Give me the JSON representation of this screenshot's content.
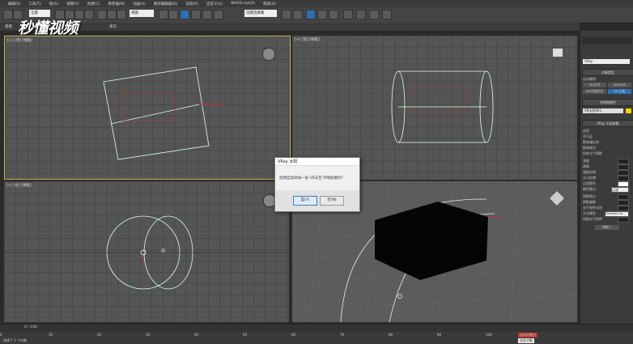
{
  "menu": [
    "编辑(E)",
    "工具(T)",
    "组(G)",
    "视图(V)",
    "创建(C)",
    "修改器(M)",
    "动画(A)",
    "图形编辑器(D)",
    "渲染(R)",
    "自定义(U)",
    "MAXScript(X)",
    "帮助(H)"
  ],
  "toolbar": {
    "select_filter": "全部",
    "view_dropdown": "视图",
    "selection_set": "创建选择集"
  },
  "logo": {
    "text": "秒懂视频"
  },
  "ribbon": {
    "left": "建模",
    "right": "填充"
  },
  "viewports": {
    "top_left": "[+] [顶] [线框]",
    "top_right": "[+] [前] [线框]",
    "bottom_left": "[+] [左] [线框]",
    "bottom_right": "[+] [透视] [真实]"
  },
  "dialog": {
    "title": "VRay 太阳",
    "message": "您想自动添加一张 VR天空 环境贴图吗？",
    "yes_label": "是(Y)",
    "no_label": "否(N)"
  },
  "command_panel": {
    "dropdown": "VRay",
    "object_type_header": "对象类型",
    "auto_grid": "自动栅格",
    "buttons": [
      "VR-灯光",
      "VRayIES",
      "VR-环境灯光",
      "VR-太阳"
    ],
    "name_color_header": "名称和颜色",
    "object_name": "VR太阳001",
    "params_header": "VRay 太阳参数",
    "params": [
      "启用",
      "不可见",
      "影响漫反射",
      "影响高光",
      "投射大气阴影",
      "浊度",
      "臭氧",
      "强度倍增",
      "大小倍增",
      "过滤颜色",
      "颜色模式",
      "阴影细分",
      "阴影偏移",
      "光子发射半径",
      "天空模型",
      "间接水平照明"
    ],
    "color_mode": "过滤",
    "sky_model": "Preetham et",
    "exclude_label": "排除..."
  },
  "timeline": {
    "position": "0 / 100",
    "ticks": [
      "0",
      "10",
      "20",
      "30",
      "40",
      "50",
      "60",
      "70",
      "80",
      "90",
      "100"
    ]
  },
  "status": {
    "selection": "选择了 1 个对象",
    "mode": "自动关键点",
    "coord": "选定对象"
  }
}
